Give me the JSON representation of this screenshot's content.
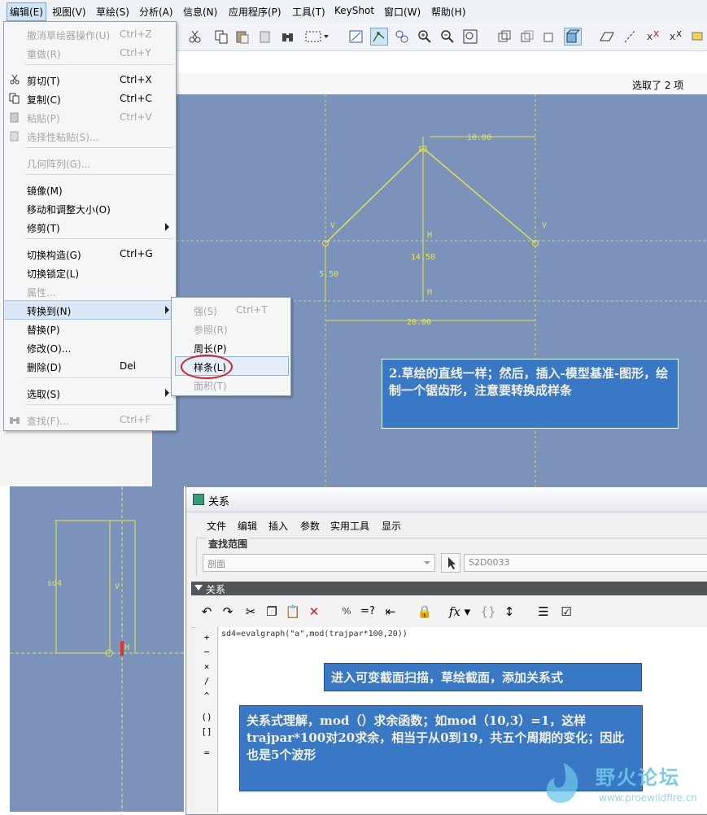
{
  "menubar": {
    "items": [
      "编辑(E)",
      "视图(V)",
      "草绘(S)",
      "分析(A)",
      "信息(N)",
      "应用程序(P)",
      "工具(T)",
      "KeyShot",
      "窗口(W)",
      "帮助(H)"
    ]
  },
  "statusbar": {
    "selected_text": "选取了  2  项"
  },
  "edit_menu": {
    "items": [
      {
        "label": "撤消草绘器操作(U)",
        "shortcut": "Ctrl+Z"
      },
      {
        "label": "重做(R)",
        "shortcut": "Ctrl+Y"
      },
      {
        "label": "剪切(T)",
        "shortcut": "Ctrl+X"
      },
      {
        "label": "复制(C)",
        "shortcut": "Ctrl+C"
      },
      {
        "label": "粘贴(P)",
        "shortcut": "Ctrl+V"
      },
      {
        "label": "选择性粘贴(S)...",
        "shortcut": ""
      },
      {
        "label": "几何阵列(G)...",
        "shortcut": ""
      },
      {
        "label": "镜像(M)",
        "shortcut": ""
      },
      {
        "label": "移动和调整大小(O)",
        "shortcut": ""
      },
      {
        "label": "修剪(T)",
        "shortcut": ""
      },
      {
        "label": "切换构造(G)",
        "shortcut": "Ctrl+G"
      },
      {
        "label": "切换锁定(L)",
        "shortcut": ""
      },
      {
        "label": "属性...",
        "shortcut": ""
      },
      {
        "label": "转换到(N)",
        "shortcut": ""
      },
      {
        "label": "替换(P)",
        "shortcut": ""
      },
      {
        "label": "修改(O)...",
        "shortcut": ""
      },
      {
        "label": "删除(D)",
        "shortcut": "Del"
      },
      {
        "label": "选取(S)",
        "shortcut": ""
      },
      {
        "label": "查找(F)...",
        "shortcut": "Ctrl+F"
      }
    ]
  },
  "convert_submenu": {
    "items": [
      {
        "label": "强(S)",
        "shortcut": "Ctrl+T"
      },
      {
        "label": "参照(R)",
        "shortcut": ""
      },
      {
        "label": "周长(P)",
        "shortcut": ""
      },
      {
        "label": "样条(L)",
        "shortcut": ""
      },
      {
        "label": "面积(T)",
        "shortcut": ""
      }
    ]
  },
  "sketch": {
    "dim_top": "10.00",
    "dim_height": "14.50",
    "dim_left": "5.50",
    "dim_bottom": "20.00",
    "label_v": "V",
    "label_h": "H"
  },
  "sketch2": {
    "dim_label": "sd4",
    "label_v": "V",
    "label_h": "H"
  },
  "notes": {
    "note1": "2.草绘的直线一样；然后，插入-模型基准-图形，绘制一个锯齿形，注意要转换成样条",
    "note2": "进入可变截面扫描，草绘截面，添加关系式",
    "note3": "关系式理解，mod（）求余函数；如mod（10,3）=1，这样trajpar*100对20求余，相当于从0到19，共五个周期的变化；因此也是5个波形"
  },
  "dialog": {
    "title": "关系",
    "menu": [
      "文件",
      "编辑",
      "插入",
      "参数",
      "实用工具",
      "显示"
    ],
    "scope_label": "查找范围",
    "scope_value": "剖面",
    "scope_item": "S2D0033",
    "relations_header": "关系",
    "formula": "sd4=evalgraph(\"a\",mod(trajpar*100,20))",
    "side_buttons": [
      "+",
      "−",
      "×",
      "/",
      "^",
      "()",
      "[]",
      "="
    ]
  },
  "watermark": {
    "title": "野火论坛",
    "url": "www.proewildfire.cn"
  },
  "colors": {
    "canvas": "#7b93bb",
    "sketch_line": "#e7e44a",
    "note_bg": "#3878c4",
    "highlight_circle": "#d0202a"
  }
}
